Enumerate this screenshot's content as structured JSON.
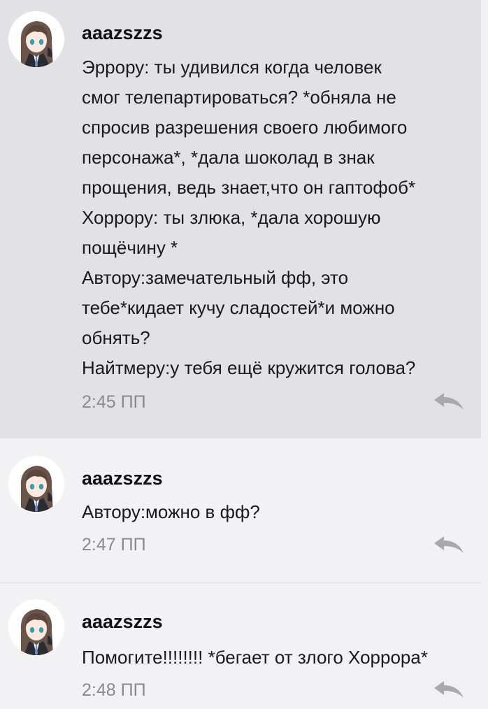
{
  "comments": [
    {
      "username": "aaazszzs",
      "message": "Эррору: ты удивился когда человек\nсмог телепартироваться? *обняла не\nспросив разрешения своего любимого\nперсонажа*, *дала шоколад в знак\nпрощения, ведь знает,что он гаптофоб*\nХоррору: ты злюка, *дала хорошую\nпощёчину *\nАвтору:замечательный фф, это\nтебе*кидает кучу сладостей*и можно\nобнять?\nНайтмеру:у тебя ещё кружится голова?",
      "time": "2:45 ПП",
      "avatar_icon": "anime-girl-avatar",
      "reply_icon": "reply-arrow-icon"
    },
    {
      "username": "aaazszzs",
      "message": "Автору:можно в фф?",
      "time": "2:47 ПП",
      "avatar_icon": "anime-girl-avatar",
      "reply_icon": "reply-arrow-icon"
    },
    {
      "username": "aaazszzs",
      "message": "Помогите!!!!!!!! *бегает от злого Хоррора*",
      "time": "2:48 ПП",
      "avatar_icon": "anime-girl-avatar",
      "reply_icon": "reply-arrow-icon"
    }
  ],
  "colors": {
    "highlight_background": "#e2e2e6",
    "background": "#f2f2f4",
    "time_text": "#8a8a8e",
    "reply_icon": "#a9a9ad"
  }
}
